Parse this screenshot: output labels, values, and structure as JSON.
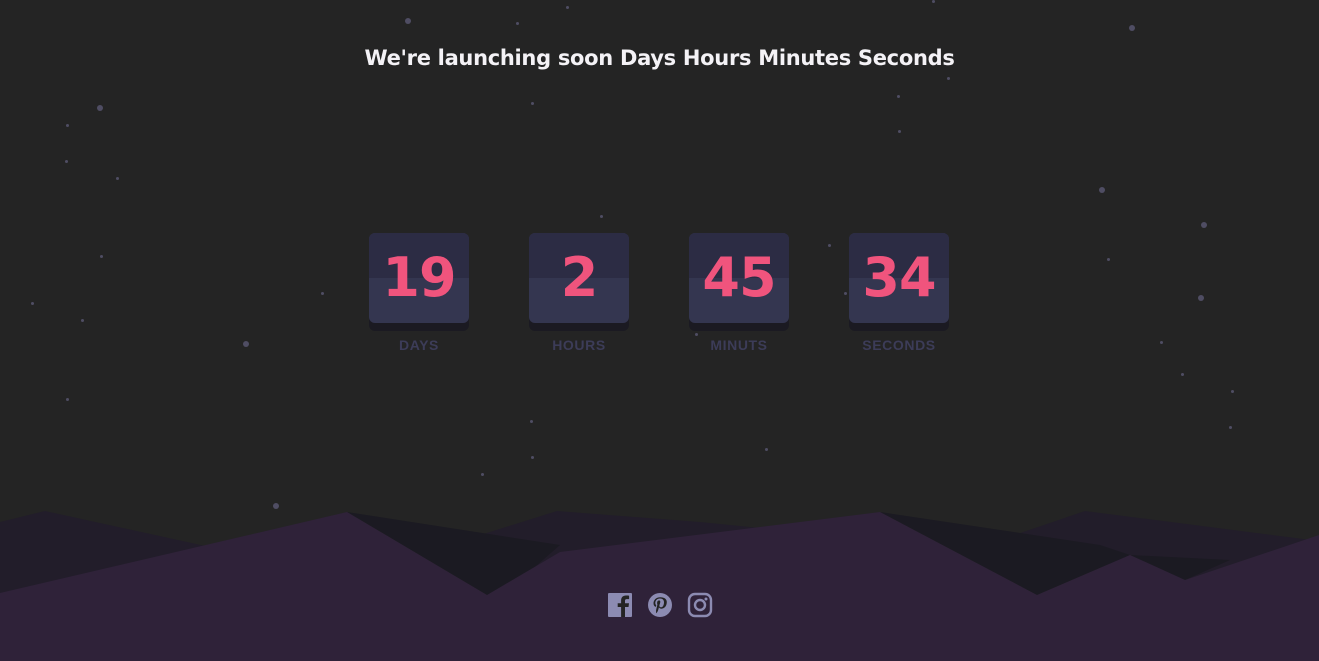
{
  "headline": "We're launching soon Days Hours Minutes Seconds",
  "countdown": [
    {
      "value": "19",
      "label": "DAYS"
    },
    {
      "value": "2",
      "label": "HOURS"
    },
    {
      "value": "45",
      "label": "MINUTS"
    },
    {
      "value": "34",
      "label": "SECONDS"
    }
  ],
  "social": [
    "facebook-icon",
    "pinterest-icon",
    "instagram-icon"
  ],
  "colors": {
    "background": "#242424",
    "card": "#343650",
    "digit": "#f0547d",
    "label": "#3c3c58",
    "hills_front": "#2f2239",
    "hills_back": "#1d1b24",
    "icon": "#8c8bb2"
  }
}
